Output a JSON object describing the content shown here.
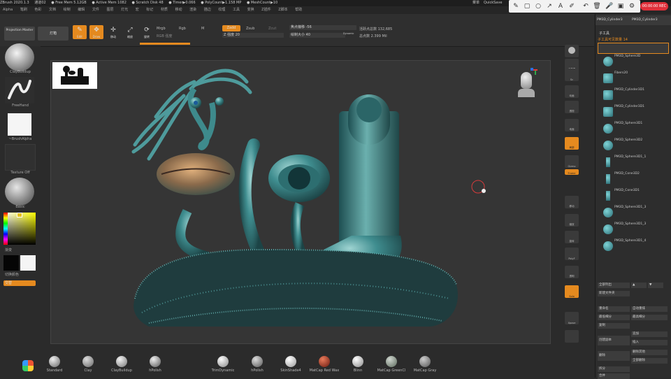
{
  "titlebar": {
    "items": [
      "ZBrush 2020.1.3",
      "通道02",
      "● Free Mem 5.12GB",
      "● Active Mem 1082",
      "● Scratch Disk 48",
      "● Timer▶0.066",
      "● PolyCount▶1.158 MP",
      "● MeshCount▶10"
    ],
    "right_items": [
      "菜单",
      "QuickSave"
    ]
  },
  "menubar": {
    "items": [
      "Alpha",
      "笔刷",
      "色彩",
      "文档",
      "绘制",
      "编辑",
      "文件",
      "图层",
      "灯光",
      "宏",
      "标记",
      "材质",
      "移动",
      "渲染",
      "描边",
      "纹理",
      "工具",
      "变换",
      "Z插件",
      "Z脚本",
      "帮助"
    ]
  },
  "annotation_toolbar": {
    "icons": [
      "pen-icon",
      "rectangle-icon",
      "circle-icon",
      "arrow-icon",
      "text-icon",
      "marker-icon",
      "undo-icon",
      "delete-icon",
      "mic-icon",
      "camera-icon",
      "settings-icon"
    ],
    "record_time": "00:00:00 REC"
  },
  "toolbar": {
    "projection_master": "Projection Master",
    "lightbox": "灯箱",
    "edit_label": "Edit",
    "draw_label": "Draw",
    "move_label": "移动",
    "scale_label": "缩放",
    "rotate_label": "旋转",
    "mrgb": "Mrgb",
    "rgb": "Rgb",
    "m": "M",
    "rgb_intensity": "RGB 强度",
    "zadd": "Zadd",
    "zsub": "Zsub",
    "zcut": "Zcut",
    "z_intensity": "Z 强度 20",
    "focal_shift": "焦点偏移 -56",
    "draw_size": "绘制大小 40",
    "dynamic": "Dynamic",
    "active_points": "活跃点总数 132,685",
    "total_points": "总点数 2.399 Mil"
  },
  "left_tray": {
    "brush_label": "ClayBuildup",
    "stroke_label": "FreeHand",
    "alpha_label": "~BrushAlpha",
    "texture_label": "Texture Off",
    "material_label": "Basic",
    "gradient_label": "渐变",
    "switch_color": "切换颜色",
    "alternate": "交替"
  },
  "right_panel": {
    "top_tabs": [
      "PM3D_Cylinder3",
      "PM3D_Cylinder3"
    ],
    "subtool_title": "子工具",
    "subtool_count": "子工具可见数量 14",
    "subtools": [
      "PM3D_Sphere3D",
      "Fibers20",
      "PM3D_Cylinder3D1",
      "PM3D_Cylinder3D1",
      "PM3D_Sphere3D1",
      "PM3D_Sphere3D2",
      "PM3D_Sphere3D1_1",
      "PM3D_Cone3D2",
      "PM3D_Cone3D1",
      "PM3D_Sphere3D1_3",
      "PM3D_Sphere3D1_3",
      "PM3D_Sphere3D1_4"
    ],
    "list_all": "全部列出",
    "new_folder": "新建文件夹",
    "rename": "重命名",
    "auto_reorder": "自动重排",
    "all_low": "最低细分",
    "all_high": "最高细分",
    "copy": "复制",
    "append": "追加",
    "create_blank": "创建副本",
    "insert": "插入",
    "delete": "删除",
    "delete_other": "删除其他",
    "delete_all": "全部删除",
    "split": "拆分",
    "merge": "合并"
  },
  "right_strip": {
    "buttons": [
      "BPR",
      "子像素",
      "Sc",
      "动画",
      "透视",
      "地面",
      "局部",
      "Gizmo",
      "Frame",
      "移动",
      "缩放",
      "旋转",
      "PolyF",
      "透明",
      "Solo",
      "Xpose"
    ]
  },
  "shelf": {
    "materials": [
      "Standard",
      "Clay",
      "ClayBuildup",
      "hPolish",
      "TrimDynamic",
      "hPolish",
      "SkinShade4",
      "MatCap Red Wax",
      "Blinn",
      "MatCap GreenCl",
      "MatCap Gray"
    ]
  },
  "colors": {
    "accent": "#e58a1f",
    "teal": "#3e8a8c"
  }
}
